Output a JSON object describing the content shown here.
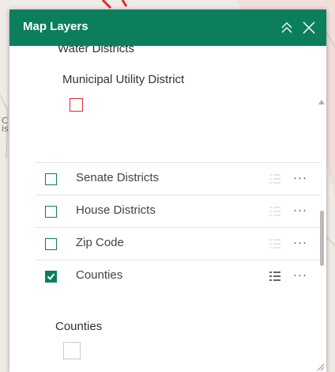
{
  "panel": {
    "title": "Map Layers",
    "header_color": "#0b7f5b"
  },
  "map": {
    "edge_label": "C\nis"
  },
  "water_districts": {
    "title": "Water Districts",
    "legend_label": "Municipal Utility District",
    "swatch_color": "#e02b2b"
  },
  "layers": [
    {
      "label": "Senate Districts",
      "checked": false
    },
    {
      "label": "House Districts",
      "checked": false
    },
    {
      "label": "Zip Code",
      "checked": false
    },
    {
      "label": "Counties",
      "checked": true
    }
  ],
  "more_label": "···",
  "counties_legend": {
    "label": "Counties",
    "swatch_color": "#c9c9c9"
  }
}
